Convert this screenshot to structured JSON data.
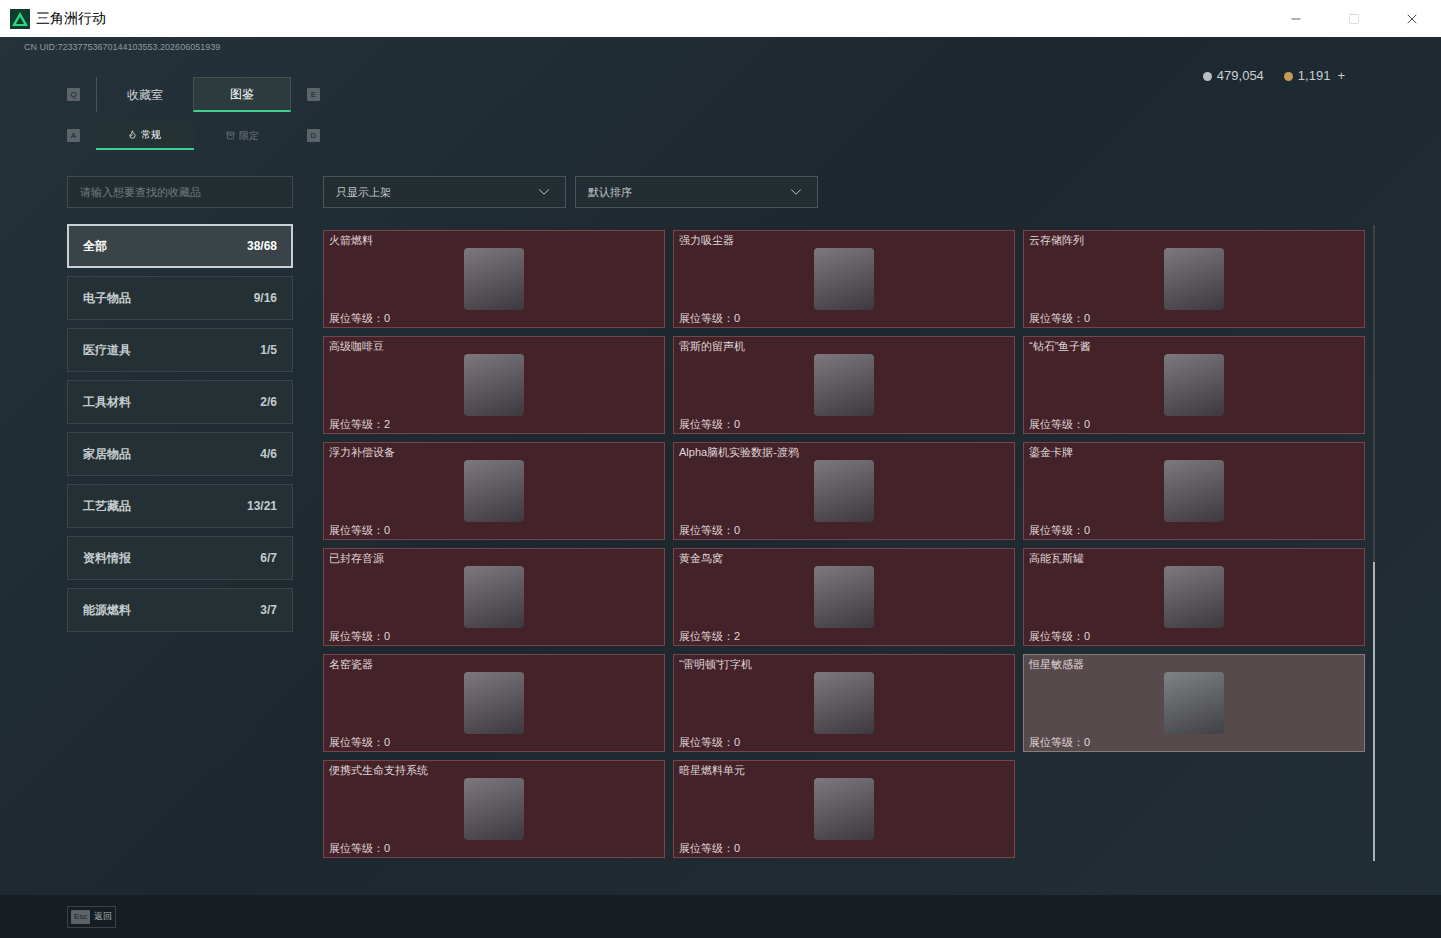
{
  "window": {
    "title": "三角洲行动"
  },
  "uid": "CN UID:72337753670144103553.202606051939",
  "currencies": [
    {
      "value": "479,054",
      "color": "#b9bec2"
    },
    {
      "value": "1,191",
      "color": "#c99a55"
    }
  ],
  "add_currency": "+",
  "main_tabs": {
    "prev_key": "Q",
    "next_key": "E",
    "items": [
      {
        "label": "收藏室",
        "selected": false
      },
      {
        "label": "图鉴",
        "selected": true
      }
    ]
  },
  "sub_tabs": {
    "prev_key": "A",
    "next_key": "D",
    "items": [
      {
        "label": "常规",
        "selected": true
      },
      {
        "label": "限定",
        "selected": false
      }
    ]
  },
  "search": {
    "placeholder": "请输入想要查找的收藏品"
  },
  "filters": [
    {
      "value": "只显示上架"
    },
    {
      "value": "默认排序"
    }
  ],
  "categories": [
    {
      "label": "全部",
      "count": "38/68",
      "selected": true
    },
    {
      "label": "电子物品",
      "count": "9/16",
      "selected": false
    },
    {
      "label": "医疗道具",
      "count": "1/5",
      "selected": false
    },
    {
      "label": "工具材料",
      "count": "2/6",
      "selected": false
    },
    {
      "label": "家居物品",
      "count": "4/6",
      "selected": false
    },
    {
      "label": "工艺藏品",
      "count": "13/21",
      "selected": false
    },
    {
      "label": "资料情报",
      "count": "6/7",
      "selected": false
    },
    {
      "label": "能源燃料",
      "count": "3/7",
      "selected": false
    }
  ],
  "items": [
    {
      "name": "火箭燃料",
      "level_label": "展位等级：",
      "level": "0",
      "highlighted": false
    },
    {
      "name": "强力吸尘器",
      "level_label": "展位等级：",
      "level": "0",
      "highlighted": false
    },
    {
      "name": "云存储阵列",
      "level_label": "展位等级：",
      "level": "0",
      "highlighted": false
    },
    {
      "name": "高级咖啡豆",
      "level_label": "展位等级：",
      "level": "2",
      "highlighted": false
    },
    {
      "name": "雷斯的留声机",
      "level_label": "展位等级：",
      "level": "0",
      "highlighted": false
    },
    {
      "name": "“钻石”鱼子酱",
      "level_label": "展位等级：",
      "level": "0",
      "highlighted": false
    },
    {
      "name": "浮力补偿设备",
      "level_label": "展位等级：",
      "level": "0",
      "highlighted": false
    },
    {
      "name": "Alpha脑机实验数据-渡鸦",
      "level_label": "展位等级：",
      "level": "0",
      "highlighted": false
    },
    {
      "name": "鎏金卡牌",
      "level_label": "展位等级：",
      "level": "0",
      "highlighted": false
    },
    {
      "name": "已封存音源",
      "level_label": "展位等级：",
      "level": "0",
      "highlighted": false
    },
    {
      "name": "黄金鸟窝",
      "level_label": "展位等级：",
      "level": "2",
      "highlighted": false
    },
    {
      "name": "高能瓦斯罐",
      "level_label": "展位等级：",
      "level": "0",
      "highlighted": false
    },
    {
      "name": "名窑瓷器",
      "level_label": "展位等级：",
      "level": "0",
      "highlighted": false
    },
    {
      "name": "“雷明顿”打字机",
      "level_label": "展位等级：",
      "level": "0",
      "highlighted": false
    },
    {
      "name": "恒星敏感器",
      "level_label": "展位等级：",
      "level": "0",
      "highlighted": true
    },
    {
      "name": "便携式生命支持系统",
      "level_label": "展位等级：",
      "level": "0",
      "highlighted": false
    },
    {
      "name": "暗星燃料单元",
      "level_label": "展位等级：",
      "level": "0",
      "highlighted": false
    }
  ],
  "scrollbar": {
    "thumb_start": 0.53,
    "level": 0.47
  },
  "footer": {
    "key": "Esc",
    "label": "返回"
  }
}
